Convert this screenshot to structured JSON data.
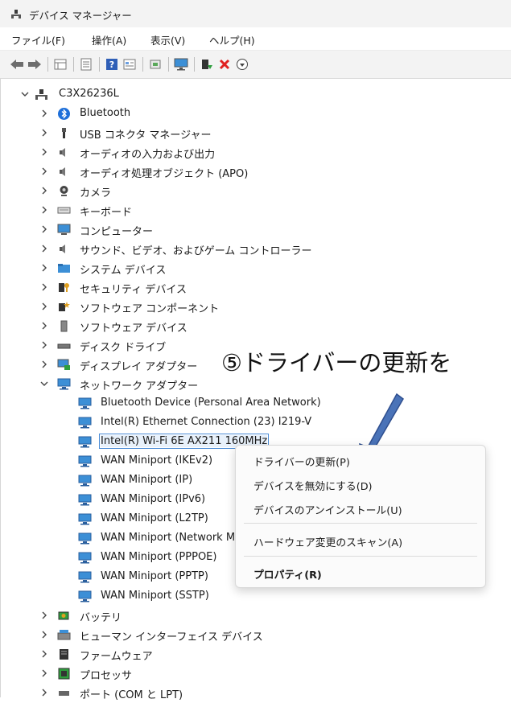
{
  "window": {
    "title": "デバイス マネージャー",
    "icon": "device-manager-icon"
  },
  "menu": [
    "ファイル(F)",
    "操作(A)",
    "表示(V)",
    "ヘルプ(H)"
  ],
  "toolbar": {
    "buttons": [
      "back-arrow-icon",
      "forward-arrow-icon",
      "properties-grid-icon",
      "show-hidden-icon",
      "help-icon",
      "view-icon",
      "scan-hardware-icon",
      "monitor-icon",
      "enable-device-icon",
      "uninstall-icon",
      "update-driver-icon"
    ]
  },
  "tree": {
    "root": "C3X26236L",
    "categories": [
      {
        "label": "Bluetooth",
        "icon": "bluetooth-icon"
      },
      {
        "label": "USB コネクタ マネージャー",
        "icon": "usb-icon"
      },
      {
        "label": "オーディオの入力および出力",
        "icon": "speaker-icon"
      },
      {
        "label": "オーディオ処理オブジェクト (APO)",
        "icon": "speaker-icon"
      },
      {
        "label": "カメラ",
        "icon": "camera-icon"
      },
      {
        "label": "キーボード",
        "icon": "keyboard-icon"
      },
      {
        "label": "コンピューター",
        "icon": "computer-icon"
      },
      {
        "label": "サウンド、ビデオ、およびゲーム コントローラー",
        "icon": "speaker-icon"
      },
      {
        "label": "システム デバイス",
        "icon": "system-folder-icon"
      },
      {
        "label": "セキュリティ デバイス",
        "icon": "security-key-icon"
      },
      {
        "label": "ソフトウェア コンポーネント",
        "icon": "software-component-icon"
      },
      {
        "label": "ソフトウェア デバイス",
        "icon": "software-device-icon"
      },
      {
        "label": "ディスク ドライブ",
        "icon": "disk-drive-icon"
      },
      {
        "label": "ディスプレイ アダプター",
        "icon": "display-adapter-icon"
      },
      {
        "label": "ネットワーク アダプター",
        "icon": "network-adapter-icon"
      }
    ],
    "network_children": [
      "Bluetooth Device (Personal Area Network)",
      "Intel(R) Ethernet Connection (23) I219-V",
      "Intel(R) Wi-Fi 6E AX211 160MHz",
      "WAN Miniport (IKEv2)",
      "WAN Miniport (IP)",
      "WAN Miniport (IPv6)",
      "WAN Miniport (L2TP)",
      "WAN Miniport (Network Monitor)",
      "WAN Miniport (PPPOE)",
      "WAN Miniport (PPTP)",
      "WAN Miniport (SSTP)"
    ],
    "after": [
      {
        "label": "バッテリ",
        "icon": "battery-icon"
      },
      {
        "label": "ヒューマン インターフェイス デバイス",
        "icon": "hid-icon"
      },
      {
        "label": "ファームウェア",
        "icon": "firmware-icon"
      },
      {
        "label": "プロセッサ",
        "icon": "processor-icon"
      },
      {
        "label": "ポート (COM と LPT)",
        "icon": "port-icon"
      }
    ]
  },
  "annotation": "⑤ドライバーの更新を",
  "context_menu": {
    "items": [
      "ドライバーの更新(P)",
      "デバイスを無効にする(D)",
      "デバイスのアンインストール(U)",
      "ハードウェア変更のスキャン(A)",
      "プロパティ(R)"
    ]
  },
  "colors": {
    "accent": "#4a8bd6",
    "arrow": "#4a73b8",
    "uninstall": "#e02020"
  }
}
